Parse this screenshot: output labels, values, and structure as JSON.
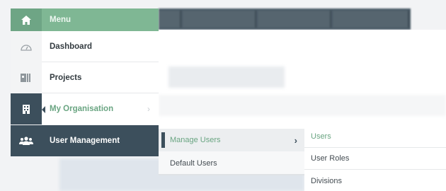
{
  "menu": {
    "header": {
      "label": "Menu",
      "icon": "home-icon"
    },
    "items": [
      {
        "label": "Dashboard",
        "icon": "dashboard-icon"
      },
      {
        "label": "Projects",
        "icon": "projects-icon"
      },
      {
        "label": "My Organisation",
        "icon": "building-icon"
      },
      {
        "label": "User Management",
        "icon": "users-icon"
      }
    ]
  },
  "submenu": {
    "items": [
      {
        "label": "Manage Users",
        "active": true
      },
      {
        "label": "Default Users"
      }
    ]
  },
  "subsubmenu": {
    "items": [
      {
        "label": "Users",
        "active": true
      },
      {
        "label": "User Roles"
      },
      {
        "label": "Divisions"
      }
    ]
  },
  "colors": {
    "accent_green": "#7fb794",
    "active_text_green": "#6aa582",
    "dark_slate": "#3c4f5c"
  }
}
